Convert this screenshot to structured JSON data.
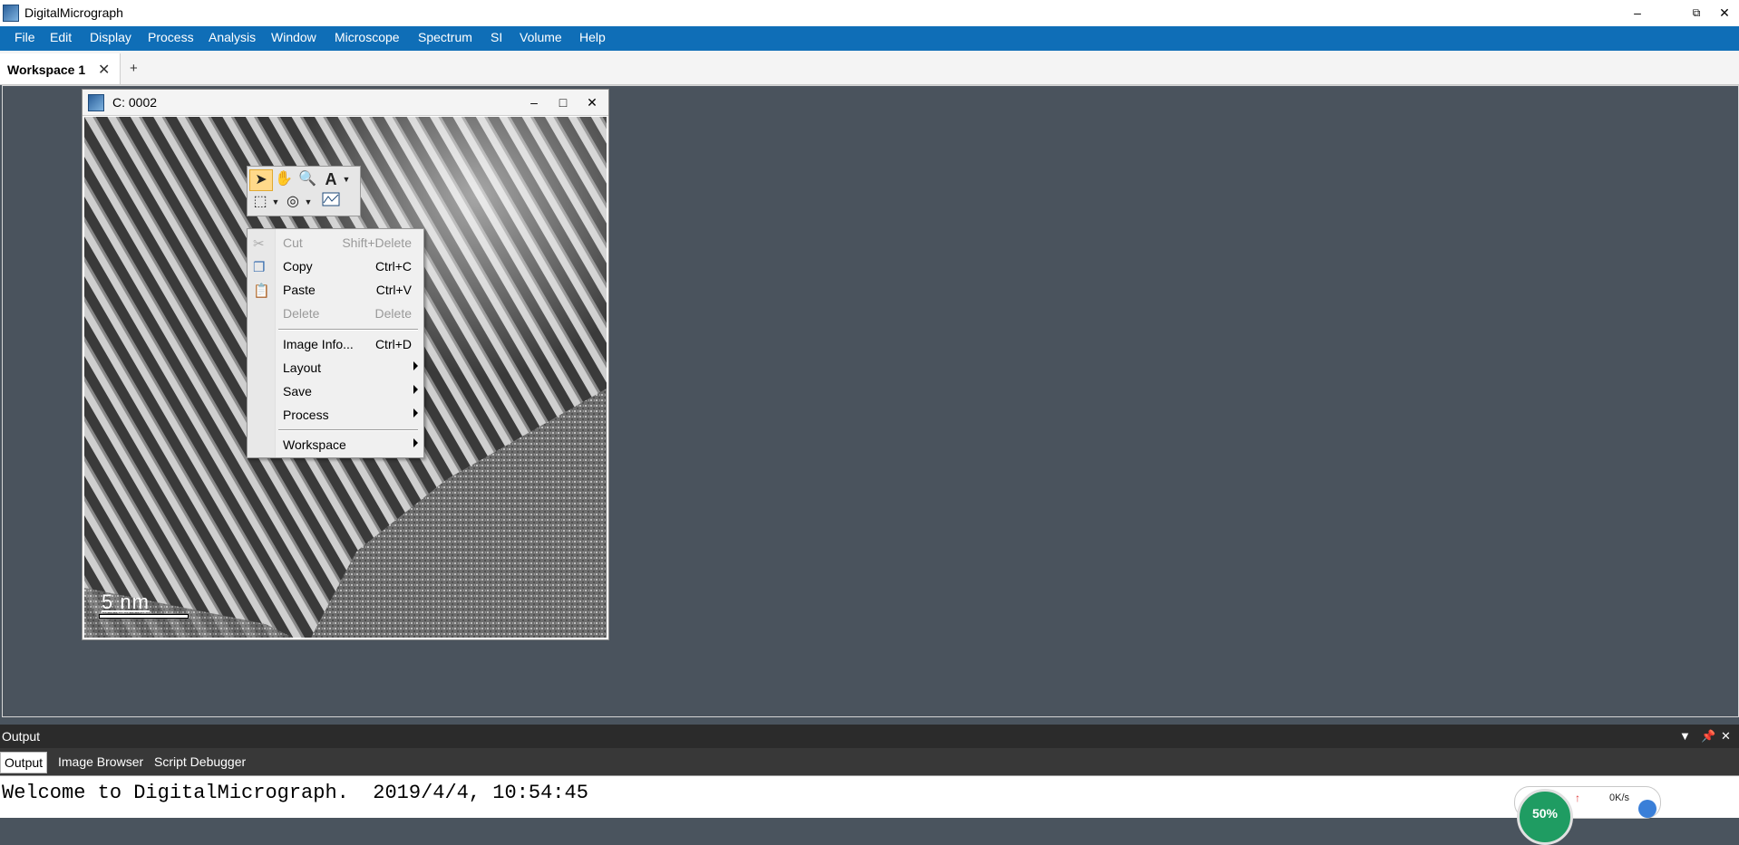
{
  "app": {
    "title": "DigitalMicrograph"
  },
  "window_controls": {
    "minimize": "–",
    "restore": "⧉",
    "close": "✕"
  },
  "menu": [
    "File",
    "Edit",
    "Display",
    "Process",
    "Analysis",
    "Window",
    "Microscope",
    "Spectrum",
    "SI",
    "Volume",
    "Help"
  ],
  "workspace_tabs": {
    "active": "Workspace 1",
    "close": "✕",
    "add": "+"
  },
  "image_window": {
    "title": "C: 0002",
    "minimize": "–",
    "maximize": "□",
    "close": "✕",
    "scale_bar_label": "5 nm"
  },
  "tool_palette": {
    "tools": [
      "pointer-tool",
      "hand-tool",
      "zoom-tool",
      "text-tool",
      "rectangle-roi-tool",
      "circle-roi-tool",
      "profile-tool"
    ]
  },
  "context_menu": {
    "items": [
      {
        "label": "Cut",
        "shortcut": "Shift+Delete",
        "disabled": true,
        "icon": "scissors-icon"
      },
      {
        "label": "Copy",
        "shortcut": "Ctrl+C",
        "disabled": false,
        "icon": "copy-icon"
      },
      {
        "label": "Paste",
        "shortcut": "Ctrl+V",
        "disabled": false,
        "icon": "paste-icon"
      },
      {
        "label": "Delete",
        "shortcut": "Delete",
        "disabled": true
      },
      {
        "label": "Image Info...",
        "shortcut": "Ctrl+D",
        "disabled": false
      },
      {
        "label": "Layout",
        "submenu": true
      },
      {
        "label": "Save",
        "submenu": true
      },
      {
        "label": "Process",
        "submenu": true
      },
      {
        "label": "Workspace",
        "submenu": true
      }
    ]
  },
  "output_panel": {
    "title": "Output",
    "tabs": [
      "Output",
      "Image Browser",
      "Script Debugger"
    ],
    "active_tab": "Output",
    "console_text": "Welcome to DigitalMicrograph.  2019/4/4, 10:54:45"
  },
  "net_widget": {
    "percent": "50%",
    "speed": "0K/s"
  }
}
